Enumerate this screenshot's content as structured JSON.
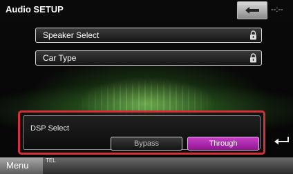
{
  "header": {
    "title": "Audio SETUP",
    "back_icon": "back-arrow-icon",
    "clock": "--:--"
  },
  "setup_items": [
    {
      "label": "Speaker Select",
      "icon": "lock-icon"
    },
    {
      "label": "Car Type",
      "icon": "lock-icon"
    }
  ],
  "dsp": {
    "label": "DSP Select",
    "options": [
      "Bypass",
      "Through"
    ],
    "selected": "Through",
    "highlight_color": "#d6303a",
    "selected_color": "#b52fb5"
  },
  "return_icon": "return-arrow-icon",
  "footer": {
    "menu_label": "Menu",
    "tel_label": "TEL"
  }
}
